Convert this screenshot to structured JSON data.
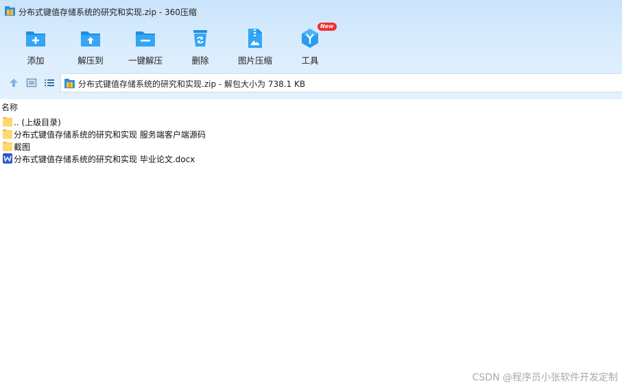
{
  "window": {
    "title": "分布式键值存储系统的研究和实现.zip - 360压缩"
  },
  "toolbar": {
    "buttons": [
      {
        "label": "添加",
        "icon": "folder-add-icon"
      },
      {
        "label": "解压到",
        "icon": "folder-extract-icon"
      },
      {
        "label": "一键解压",
        "icon": "folder-one-click-icon"
      },
      {
        "label": "删除",
        "icon": "recycle-bin-icon"
      },
      {
        "label": "图片压缩",
        "icon": "image-compress-icon"
      },
      {
        "label": "工具",
        "icon": "tools-icon",
        "badge": "New"
      }
    ]
  },
  "nav": {
    "icons": [
      "up-arrow-icon",
      "thumbnail-view-icon",
      "list-view-icon"
    ],
    "address": "分布式键值存储系统的研究和实现.zip - 解包大小为 738.1 KB"
  },
  "filelist": {
    "header": "名称",
    "items": [
      {
        "name": ".. (上级目录)",
        "type": "folder"
      },
      {
        "name": "分布式键值存储系统的研究和实现 服务端客户端源码",
        "type": "folder"
      },
      {
        "name": "截图",
        "type": "folder"
      },
      {
        "name": "分布式键值存储系统的研究和实现 毕业论文.docx",
        "type": "word"
      }
    ]
  },
  "watermark": "CSDN @程序员小张软件开发定制",
  "colors": {
    "accent": "#1c96e8",
    "background_band": "#d9ecfd",
    "folder": "#ffd970",
    "word": "#2b5cc4",
    "badge": "#ef2f2f"
  }
}
